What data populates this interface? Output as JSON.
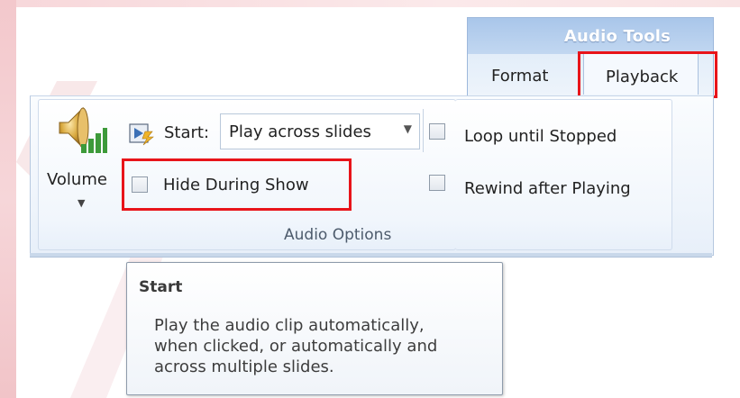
{
  "contextual_group": {
    "title": "Audio Tools"
  },
  "tabs": [
    {
      "label": "Format"
    },
    {
      "label": "Playback"
    }
  ],
  "ribbon": {
    "volume": {
      "label": "Volume",
      "icon": "speaker-volume-icon"
    },
    "start": {
      "label": "Start:",
      "value": "Play across slides",
      "icon": "play-start-icon"
    },
    "hide_during_show": {
      "label": "Hide During Show",
      "checked": false
    },
    "loop_until_stopped": {
      "label": "Loop until Stopped",
      "checked": false
    },
    "rewind_after_playing": {
      "label": "Rewind after Playing",
      "checked": false
    },
    "group_label": "Audio Options"
  },
  "tooltip": {
    "title": "Start",
    "lines": [
      "Play the audio clip automatically,",
      "when clicked, or automatically and",
      "across multiple slides."
    ]
  },
  "colors": {
    "highlight": "#e8141a",
    "contextual_header": "#a9c6ea",
    "ribbon_bg": "#eef4fb"
  }
}
